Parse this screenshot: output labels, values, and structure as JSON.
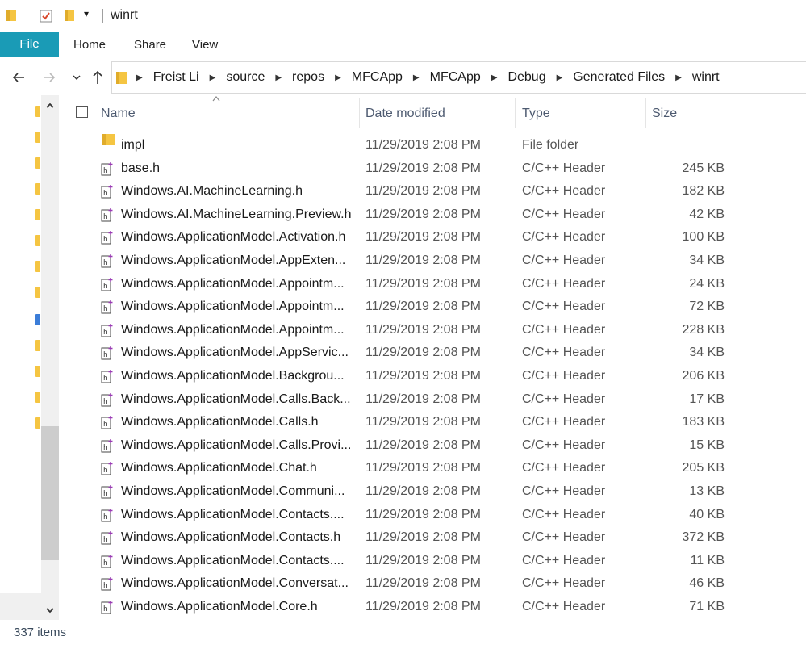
{
  "window": {
    "title": "winrt"
  },
  "ribbon": {
    "tabs": [
      "File",
      "Home",
      "Share",
      "View"
    ]
  },
  "nav": {
    "back_icon": "arrow-left-icon",
    "forward_icon": "arrow-right-icon",
    "recent_icon": "chevron-down-icon",
    "up_icon": "arrow-up-icon"
  },
  "breadcrumb": [
    "Freist Li",
    "source",
    "repos",
    "MFCApp",
    "MFCApp",
    "Debug",
    "Generated Files",
    "winrt"
  ],
  "columns": {
    "name": "Name",
    "date": "Date modified",
    "type": "Type",
    "size": "Size"
  },
  "files": [
    {
      "name": "impl",
      "date": "11/29/2019 2:08 PM",
      "type": "File folder",
      "size": "",
      "kind": "folder"
    },
    {
      "name": "base.h",
      "date": "11/29/2019 2:08 PM",
      "type": "C/C++ Header",
      "size": "245 KB",
      "kind": "header"
    },
    {
      "name": "Windows.AI.MachineLearning.h",
      "date": "11/29/2019 2:08 PM",
      "type": "C/C++ Header",
      "size": "182 KB",
      "kind": "header"
    },
    {
      "name": "Windows.AI.MachineLearning.Preview.h",
      "date": "11/29/2019 2:08 PM",
      "type": "C/C++ Header",
      "size": "42 KB",
      "kind": "header"
    },
    {
      "name": "Windows.ApplicationModel.Activation.h",
      "date": "11/29/2019 2:08 PM",
      "type": "C/C++ Header",
      "size": "100 KB",
      "kind": "header"
    },
    {
      "name": "Windows.ApplicationModel.AppExten...",
      "date": "11/29/2019 2:08 PM",
      "type": "C/C++ Header",
      "size": "34 KB",
      "kind": "header"
    },
    {
      "name": "Windows.ApplicationModel.Appointm...",
      "date": "11/29/2019 2:08 PM",
      "type": "C/C++ Header",
      "size": "24 KB",
      "kind": "header"
    },
    {
      "name": "Windows.ApplicationModel.Appointm...",
      "date": "11/29/2019 2:08 PM",
      "type": "C/C++ Header",
      "size": "72 KB",
      "kind": "header"
    },
    {
      "name": "Windows.ApplicationModel.Appointm...",
      "date": "11/29/2019 2:08 PM",
      "type": "C/C++ Header",
      "size": "228 KB",
      "kind": "header"
    },
    {
      "name": "Windows.ApplicationModel.AppServic...",
      "date": "11/29/2019 2:08 PM",
      "type": "C/C++ Header",
      "size": "34 KB",
      "kind": "header"
    },
    {
      "name": "Windows.ApplicationModel.Backgrou...",
      "date": "11/29/2019 2:08 PM",
      "type": "C/C++ Header",
      "size": "206 KB",
      "kind": "header"
    },
    {
      "name": "Windows.ApplicationModel.Calls.Back...",
      "date": "11/29/2019 2:08 PM",
      "type": "C/C++ Header",
      "size": "17 KB",
      "kind": "header"
    },
    {
      "name": "Windows.ApplicationModel.Calls.h",
      "date": "11/29/2019 2:08 PM",
      "type": "C/C++ Header",
      "size": "183 KB",
      "kind": "header"
    },
    {
      "name": "Windows.ApplicationModel.Calls.Provi...",
      "date": "11/29/2019 2:08 PM",
      "type": "C/C++ Header",
      "size": "15 KB",
      "kind": "header"
    },
    {
      "name": "Windows.ApplicationModel.Chat.h",
      "date": "11/29/2019 2:08 PM",
      "type": "C/C++ Header",
      "size": "205 KB",
      "kind": "header"
    },
    {
      "name": "Windows.ApplicationModel.Communi...",
      "date": "11/29/2019 2:08 PM",
      "type": "C/C++ Header",
      "size": "13 KB",
      "kind": "header"
    },
    {
      "name": "Windows.ApplicationModel.Contacts....",
      "date": "11/29/2019 2:08 PM",
      "type": "C/C++ Header",
      "size": "40 KB",
      "kind": "header"
    },
    {
      "name": "Windows.ApplicationModel.Contacts.h",
      "date": "11/29/2019 2:08 PM",
      "type": "C/C++ Header",
      "size": "372 KB",
      "kind": "header"
    },
    {
      "name": "Windows.ApplicationModel.Contacts....",
      "date": "11/29/2019 2:08 PM",
      "type": "C/C++ Header",
      "size": "11 KB",
      "kind": "header"
    },
    {
      "name": "Windows.ApplicationModel.Conversat...",
      "date": "11/29/2019 2:08 PM",
      "type": "C/C++ Header",
      "size": "46 KB",
      "kind": "header"
    },
    {
      "name": "Windows.ApplicationModel.Core.h",
      "date": "11/29/2019 2:08 PM",
      "type": "C/C++ Header",
      "size": "71 KB",
      "kind": "header"
    }
  ],
  "status": {
    "item_count": "337 items"
  },
  "colors": {
    "file_tab": "#1a9bb6",
    "folder": "#f5c542",
    "header_text": "#4d5a70",
    "header_icon_accent": "#9b3bb5"
  }
}
